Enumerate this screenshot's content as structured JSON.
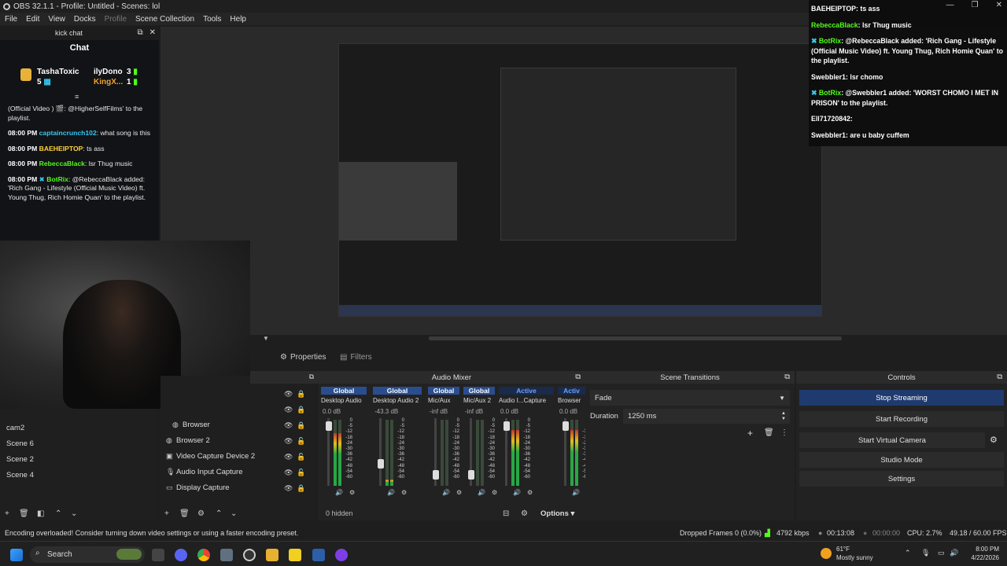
{
  "window": {
    "title": "OBS 32.1.1 - Profile: Untitled - Scenes: lol"
  },
  "menu": [
    "File",
    "Edit",
    "View",
    "Docks",
    "Profile",
    "Scene Collection",
    "Tools",
    "Help"
  ],
  "kick_dock": {
    "title": "kick chat",
    "chat_title": "Chat"
  },
  "leaderboard": [
    {
      "name": "TashaToxic",
      "count": "5"
    },
    {
      "name": "ilyDono",
      "count": "3"
    },
    {
      "name": "KingX...",
      "count": "1"
    }
  ],
  "chat_messages": {
    "m1_text": "(Official Video ) 🎬: @HigherSelfFilms' to the playlist.",
    "m2_time": "08:00 PM",
    "m2_user": "captaincrunch102",
    "m2_text": ": what song is this",
    "m3_time": "08:00 PM",
    "m3_user": "BAEHEIPTOP",
    "m3_text": ": ts ass",
    "m4_time": "08:00 PM",
    "m4_user": "RebeccaBlack",
    "m4_text": ": lsr Thug music",
    "m5_time": "08:00 PM",
    "m5_user": "BotRix",
    "m5_text": ": @RebeccaBlack added: 'Rich Gang - Lifestyle (Official Music Video) ft. Young Thug, Rich Homie Quan' to the playlist."
  },
  "overlay_chat": {
    "o1_user": "BAEHEIPTOP",
    "o1_text": ": ts ass",
    "o2_user": "RebeccaBlack",
    "o2_text": ": lsr Thug music",
    "o3_user": "BotRix",
    "o3_text": ": @RebeccaBlack added: 'Rich Gang - Lifestyle (Official Music Video) ft. Young Thug, Rich Homie Quan' to the playlist.",
    "o4_user": "Swebbler1",
    "o4_text": ": lsr chomo",
    "o5_user": "BotRix",
    "o5_text": ": @Swebbler1 added: 'WORST CHOMO I MET IN PRISON' to the playlist.",
    "o6_user": "Ell71720842",
    "o6_text": ":",
    "o7_user": "Swebbler1",
    "o7_text": ": are u baby cuffem"
  },
  "tabs": {
    "properties": "Properties",
    "filters": "Filters"
  },
  "scenes": [
    "cam2",
    "Scene 6",
    "Scene 2",
    "Scene 4"
  ],
  "sources": [
    "Browser",
    "Browser 2",
    "Video Capture Device 2",
    "Audio Input Capture",
    "Display Capture"
  ],
  "audio_mixer": {
    "title": "Audio Mixer",
    "channels": [
      {
        "badge": "Global",
        "name": "Desktop Audio",
        "db": "0.0 dB",
        "level": 0.8
      },
      {
        "badge": "Global",
        "name": "Desktop Audio 2",
        "db": "-43.3 dB",
        "level": 0.1
      },
      {
        "badge": "Global",
        "name": "Mic/Aux",
        "db": "-inf dB",
        "level": 0.0
      },
      {
        "badge": "Global",
        "name": "Mic/Aux 2",
        "db": "-inf dB",
        "level": 0.0
      },
      {
        "badge": "Active",
        "name": "Audio I...Capture",
        "db": "0.0 dB",
        "level": 0.85
      },
      {
        "badge": "Activ",
        "name": "Browser",
        "db": "0.0 dB",
        "level": 0.85
      }
    ],
    "scale": [
      "0",
      "-5",
      "-12",
      "-18",
      "-24",
      "-30",
      "-36",
      "-42",
      "-48",
      "-54",
      "-60"
    ],
    "hidden": "0 hidden",
    "options": "Options"
  },
  "scene_transitions": {
    "title": "Scene Transitions",
    "transition": "Fade",
    "duration_label": "Duration",
    "duration_value": "1250 ms"
  },
  "controls": {
    "title": "Controls",
    "stop_streaming": "Stop Streaming",
    "start_recording": "Start Recording",
    "start_virtual_camera": "Start Virtual Camera",
    "studio_mode": "Studio Mode",
    "settings": "Settings"
  },
  "status": {
    "message": "Encoding overloaded! Consider turning down video settings or using a faster encoding preset.",
    "dropped": "Dropped Frames 0 (0.0%)",
    "bitrate": "4792 kbps",
    "stream_time": "00:13:08",
    "rec_time": "00:00:00",
    "cpu": "CPU: 2.7%",
    "fps": "49.18 / 60.00 FPS"
  },
  "taskbar": {
    "search": "Search",
    "weather_temp": "61°F",
    "weather_desc": "Mostly sunny",
    "time": "8:00 PM",
    "date": "4/22/2026"
  },
  "colors": {
    "accent": "#2a4d8f",
    "kick_green": "#53fc18",
    "stop_btn": "#1f3a6e"
  }
}
